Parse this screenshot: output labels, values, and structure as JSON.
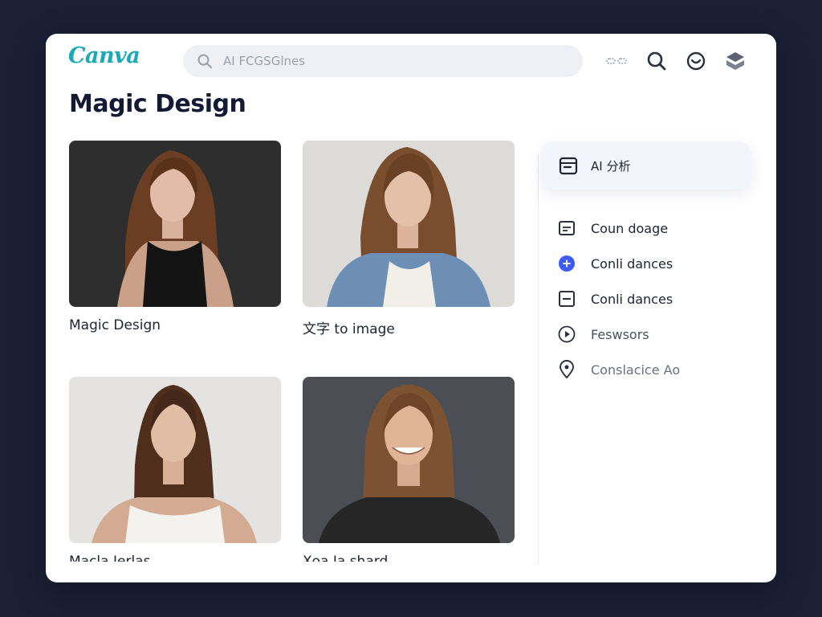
{
  "app": {
    "brand": "Canva"
  },
  "search": {
    "placeholder": "AI FCGSGlnes"
  },
  "header_icons": [
    {
      "icon": "link-icon"
    },
    {
      "icon": "search-icon"
    },
    {
      "icon": "chat-icon"
    },
    {
      "icon": "layers-icon"
    }
  ],
  "page": {
    "title": "Magic Design"
  },
  "cards": [
    {
      "label": "Magic Design",
      "bg": "#2e2e2e"
    },
    {
      "label": "文字 to image",
      "bg": "#dcdbd8"
    },
    {
      "label": "Macla Ierlas",
      "bg": "#e4e3e1"
    },
    {
      "label": "Xoa Ia shard",
      "bg": "#4b4e55"
    }
  ],
  "sidebar": {
    "top_item": {
      "label": "AI 分析",
      "icon": "calendar-icon"
    },
    "items": [
      {
        "label": "Coun doage",
        "icon": "document-icon"
      },
      {
        "label": "Conli dances",
        "icon": "plus-circle-icon"
      },
      {
        "label": "Conli dances",
        "icon": "minus-square-icon"
      },
      {
        "label": "Feswsors",
        "icon": "play-icon"
      },
      {
        "label": "Conslacice Ao",
        "icon": "location-pin-icon"
      }
    ]
  },
  "colors": {
    "brand": "#19aab8",
    "accent": "#3d5afe",
    "backdrop": "#1b2037"
  }
}
